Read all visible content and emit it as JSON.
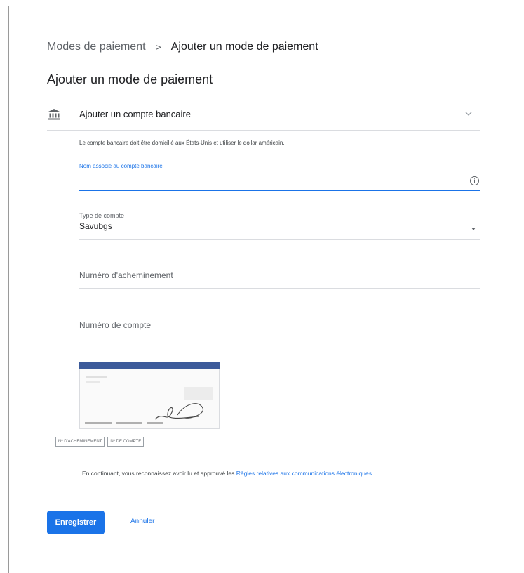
{
  "breadcrumb": {
    "parent": "Modes de paiement",
    "separator": ">",
    "current": "Ajouter un mode de paiement"
  },
  "page_title": "Ajouter un mode de paiement",
  "section": {
    "icon": "bank-icon",
    "label": "Ajouter un compte bancaire",
    "expand_icon": "chevron-down-icon"
  },
  "notice": "Le compte bancaire doit être domicilié aux États-Unis et utiliser le dollar américain.",
  "fields": {
    "name": {
      "label": "Nom associé au compte bancaire",
      "value": "",
      "info_icon": "info-icon"
    },
    "account_type": {
      "label": "Type de compte",
      "value": "Savubgs"
    },
    "routing": {
      "placeholder": "Numéro d'acheminement"
    },
    "account": {
      "placeholder": "Numéro de compte"
    }
  },
  "check": {
    "routing_label": "Nº D'ACHEMINEMENT",
    "account_label": "Nº DE COMPTE"
  },
  "consent": {
    "text": "En continuant, vous reconnaissez avoir lu et approuvé les ",
    "link": "Règles relatives aux communications électroniques",
    "end": "."
  },
  "actions": {
    "save": "Enregistrer",
    "cancel": "Annuler"
  },
  "colors": {
    "accent": "#1a73e8",
    "text": "#202124",
    "muted": "#5f6368",
    "divider": "#dadce0",
    "check_header": "#3c5a9a"
  }
}
